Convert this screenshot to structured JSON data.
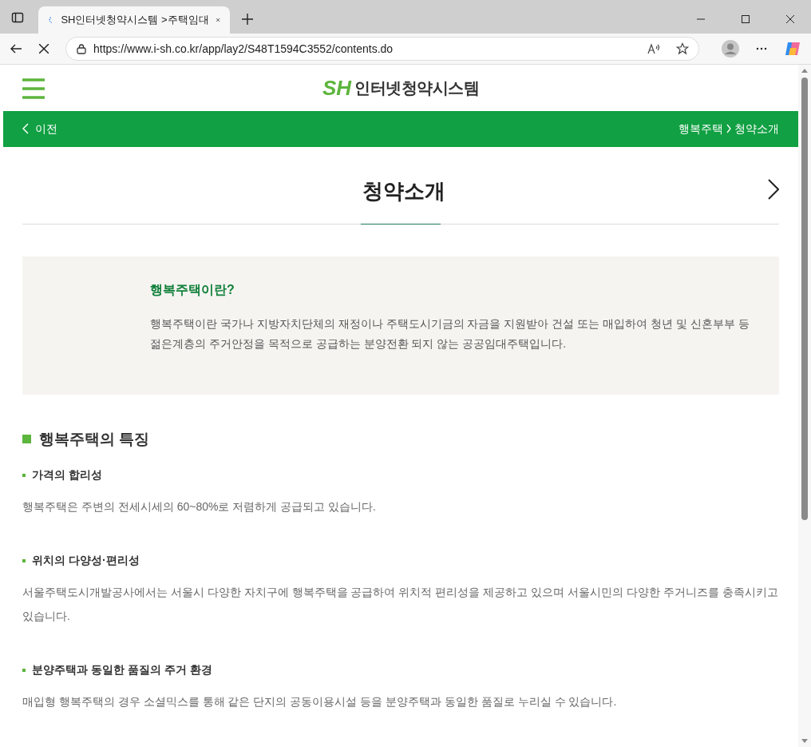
{
  "browser": {
    "tab_title": "SH인터넷청약시스템 >주택임대",
    "url": "https://www.i-sh.co.kr/app/lay2/S48T1594C3552/contents.do"
  },
  "header": {
    "logo_mark": "SH",
    "logo_text": "인터넷청약시스템"
  },
  "nav_bar": {
    "back_label": "이전",
    "breadcrumb": [
      "행복주택",
      "청약소개"
    ]
  },
  "page_title": "청약소개",
  "intro": {
    "title": "행복주택이란?",
    "body": "행복주택이란 국가나 지방자치단체의 재정이나 주택도시기금의 자금을 지원받아 건설 또는 매입하여 청년 및 신혼부부 등 젊은계층의 주거안정을 목적으로 공급하는 분양전환 되지 않는 공공임대주택입니다."
  },
  "section": {
    "title": "행복주택의 특징",
    "features": [
      {
        "title": "가격의 합리성",
        "body": "행복주택은 주변의 전세시세의 60~80%로 저렴하게 공급되고 있습니다."
      },
      {
        "title": "위치의 다양성·편리성",
        "body": "서울주택도시개발공사에서는 서울시 다양한 자치구에 행복주택을 공급하여 위치적 편리성을 제공하고 있으며 서울시민의 다양한 주거니즈를 충족시키고 있습니다."
      },
      {
        "title": "분양주택과 동일한 품질의 주거 환경",
        "body": "매입형 행복주택의 경우 소셜믹스를 통해 같은 단지의 공동이용시설 등을 분양주택과 동일한 품질로 누리실 수 있습니다."
      }
    ]
  }
}
